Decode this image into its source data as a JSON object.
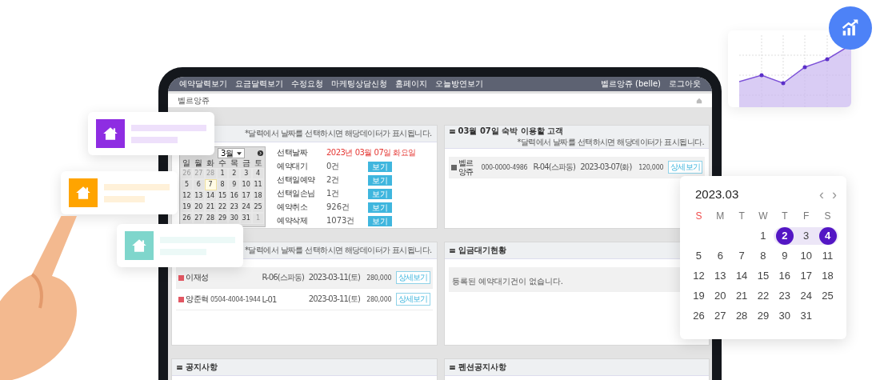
{
  "nav": {
    "items": [
      "예약달력보기",
      "요금달력보기",
      "수정요청",
      "마케팅상담신청",
      "홈페이지",
      "오늘방연보기"
    ],
    "user": "벨르앙쥬 (belle)",
    "logout": "로그아웃"
  },
  "page_title": "벨르앙쥬",
  "summary_panel": {
    "note": "*달력에서 날짜를 선택하시면 해당데이터가 표시됩니다.",
    "month_select": "3월",
    "weekdays": [
      "일",
      "월",
      "화",
      "수",
      "목",
      "금",
      "토"
    ],
    "days": [
      {
        "day": "26",
        "muted": true,
        "selected": false
      },
      {
        "day": "27",
        "muted": true,
        "selected": false
      },
      {
        "day": "28",
        "muted": true,
        "selected": false
      },
      {
        "day": "1",
        "muted": false,
        "selected": false
      },
      {
        "day": "2",
        "muted": false,
        "selected": false
      },
      {
        "day": "3",
        "muted": false,
        "selected": false
      },
      {
        "day": "4",
        "muted": false,
        "selected": false
      },
      {
        "day": "5",
        "muted": false,
        "selected": false
      },
      {
        "day": "6",
        "muted": false,
        "selected": false
      },
      {
        "day": "7",
        "muted": false,
        "selected": true
      },
      {
        "day": "8",
        "muted": false,
        "selected": false
      },
      {
        "day": "9",
        "muted": false,
        "selected": false
      },
      {
        "day": "10",
        "muted": false,
        "selected": false
      },
      {
        "day": "11",
        "muted": false,
        "selected": false
      },
      {
        "day": "12",
        "muted": false,
        "selected": false
      },
      {
        "day": "13",
        "muted": false,
        "selected": false
      },
      {
        "day": "14",
        "muted": false,
        "selected": false
      },
      {
        "day": "15",
        "muted": false,
        "selected": false
      },
      {
        "day": "16",
        "muted": false,
        "selected": false
      },
      {
        "day": "17",
        "muted": false,
        "selected": false
      },
      {
        "day": "18",
        "muted": false,
        "selected": false
      },
      {
        "day": "19",
        "muted": false,
        "selected": false
      },
      {
        "day": "20",
        "muted": false,
        "selected": false
      },
      {
        "day": "21",
        "muted": false,
        "selected": false
      },
      {
        "day": "22",
        "muted": false,
        "selected": false
      },
      {
        "day": "23",
        "muted": false,
        "selected": false
      },
      {
        "day": "24",
        "muted": false,
        "selected": false
      },
      {
        "day": "25",
        "muted": false,
        "selected": false
      },
      {
        "day": "26",
        "muted": false,
        "selected": false
      },
      {
        "day": "27",
        "muted": false,
        "selected": false
      },
      {
        "day": "28",
        "muted": false,
        "selected": false
      },
      {
        "day": "29",
        "muted": false,
        "selected": false
      },
      {
        "day": "30",
        "muted": false,
        "selected": false
      },
      {
        "day": "31",
        "muted": false,
        "selected": false
      },
      {
        "day": "1",
        "muted": true,
        "selected": false
      }
    ],
    "stats": [
      {
        "kind": "date",
        "label": "선택날짜",
        "value": "2023년 03월 07일 화요일"
      },
      {
        "kind": "count",
        "label": "예약대기",
        "value": "0건",
        "button": "보기"
      },
      {
        "kind": "count",
        "label": "선택일예약",
        "value": "2건",
        "button": "보기"
      },
      {
        "kind": "count",
        "label": "선택일손님",
        "value": "1건",
        "button": "보기"
      },
      {
        "kind": "count",
        "label": "예약취소",
        "value": "926건",
        "button": "보기"
      },
      {
        "kind": "count",
        "label": "예약삭제",
        "value": "1073건",
        "button": "보기"
      }
    ]
  },
  "guests_panel": {
    "title": "03월 07일 숙박 이용할 고객",
    "note": "*달력에서 날짜를 선택하시면 해당데이터가 표시됩니다.",
    "rows": [
      {
        "name": "벨르앙쥬",
        "phone": "000-0000-4986",
        "room": "R-04(스파동)",
        "date": "2023-03-07(화)",
        "price": "120,000",
        "button": "상세보기"
      }
    ]
  },
  "reservations_panel": {
    "note": "*달력에서 날짜를 선택하시면 해당데이터가 표시됩니다.",
    "rows": [
      {
        "name": "이재성",
        "room": "R-06(스파동)",
        "date": "2023-03-11(토)",
        "price": "280,000",
        "button": "상세보기"
      },
      {
        "name": "양준혁",
        "phone": "0504-4004-1944",
        "room": "L-01",
        "date": "2023-03-11(토)",
        "price": "280,000",
        "button": "상세보기"
      }
    ]
  },
  "deposit_panel": {
    "title": "입금대기현황",
    "empty": "등록된 예약대기건이 없습니다."
  },
  "notice_panels": [
    {
      "title": "공지사항"
    },
    {
      "title": "펜션공지사항"
    }
  ],
  "date_picker": {
    "month": "2023.03",
    "prev": "‹",
    "next": "›",
    "weekdays": [
      {
        "label": "S",
        "weekend": true
      },
      {
        "label": "M",
        "weekend": false
      },
      {
        "label": "T",
        "weekend": false
      },
      {
        "label": "W",
        "weekend": false
      },
      {
        "label": "T",
        "weekend": false
      },
      {
        "label": "F",
        "weekend": false
      },
      {
        "label": "S",
        "weekend": false
      }
    ],
    "weeks": [
      {
        "pad_before": true,
        "days": [
          {
            "day": "1",
            "selected": false,
            "in_range": false
          },
          {
            "day": "2",
            "selected": true,
            "in_range": true
          },
          {
            "day": "3",
            "selected": false,
            "in_range": true
          },
          {
            "day": "4",
            "selected": true,
            "in_range": true
          }
        ]
      },
      {
        "days": [
          {
            "day": "5",
            "selected": false,
            "in_range": false
          },
          {
            "day": "6",
            "selected": false,
            "in_range": false
          },
          {
            "day": "7",
            "selected": false,
            "in_range": false
          },
          {
            "day": "8",
            "selected": false,
            "in_range": false
          },
          {
            "day": "9",
            "selected": false,
            "in_range": false
          },
          {
            "day": "10",
            "selected": false,
            "in_range": false
          },
          {
            "day": "11",
            "selected": false,
            "in_range": false
          }
        ]
      },
      {
        "days": [
          {
            "day": "12",
            "selected": false,
            "in_range": false
          },
          {
            "day": "13",
            "selected": false,
            "in_range": false
          },
          {
            "day": "14",
            "selected": false,
            "in_range": false
          },
          {
            "day": "15",
            "selected": false,
            "in_range": false
          },
          {
            "day": "16",
            "selected": false,
            "in_range": false
          },
          {
            "day": "17",
            "selected": false,
            "in_range": false
          },
          {
            "day": "18",
            "selected": false,
            "in_range": false
          }
        ]
      },
      {
        "days": [
          {
            "day": "19",
            "selected": false,
            "in_range": false
          },
          {
            "day": "20",
            "selected": false,
            "in_range": false
          },
          {
            "day": "21",
            "selected": false,
            "in_range": false
          },
          {
            "day": "22",
            "selected": false,
            "in_range": false
          },
          {
            "day": "23",
            "selected": false,
            "in_range": false
          },
          {
            "day": "24",
            "selected": false,
            "in_range": false
          },
          {
            "day": "25",
            "selected": false,
            "in_range": false
          }
        ]
      },
      {
        "pad_before": false,
        "days": [
          {
            "day": "26",
            "selected": false,
            "in_range": false
          },
          {
            "day": "27",
            "selected": false,
            "in_range": false
          },
          {
            "day": "28",
            "selected": false,
            "in_range": false
          },
          {
            "day": "29",
            "selected": false,
            "in_range": false
          },
          {
            "day": "30",
            "selected": false,
            "in_range": false
          },
          {
            "day": "31",
            "selected": false,
            "in_range": false
          }
        ]
      }
    ]
  },
  "cards": [
    {
      "color": "#8e2de2"
    },
    {
      "color": "#ffa400"
    },
    {
      "color": "#7fd6cc"
    }
  ]
}
